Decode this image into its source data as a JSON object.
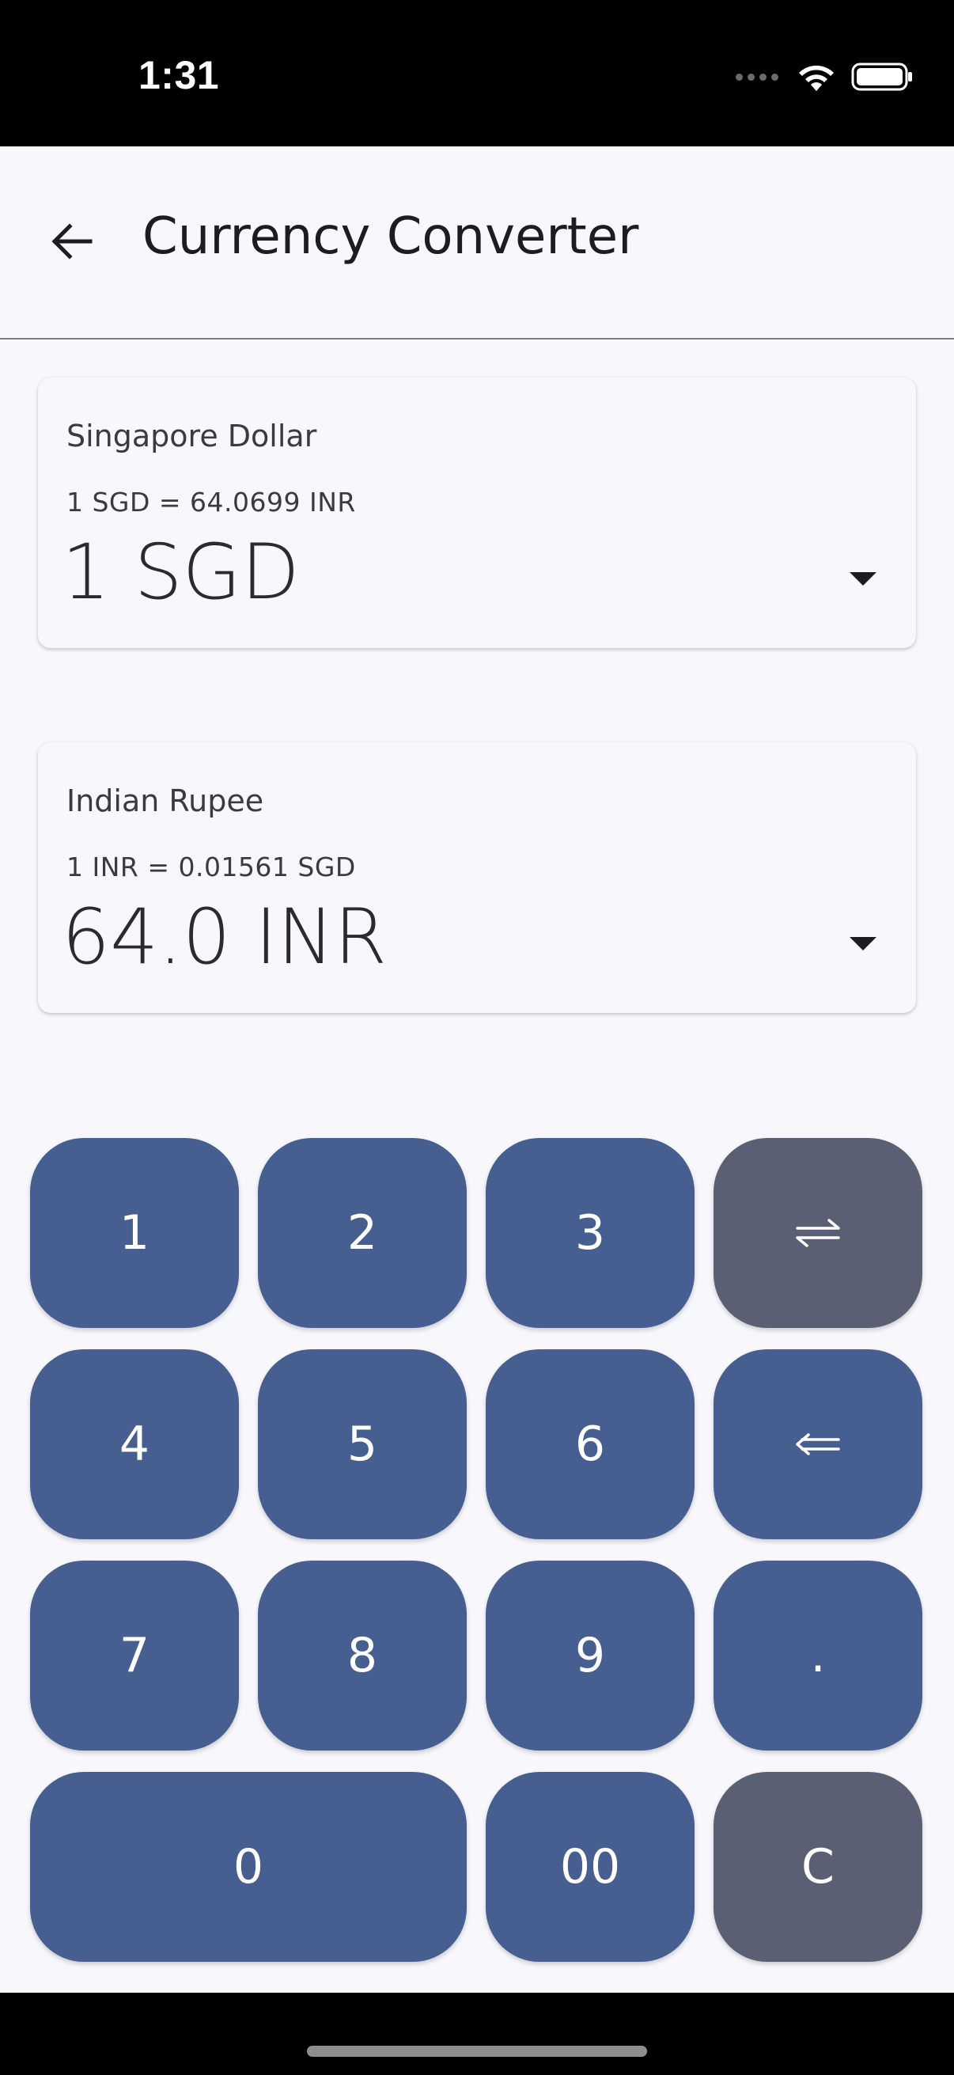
{
  "status_bar": {
    "time": "1:31"
  },
  "app_bar": {
    "title": "Currency Converter"
  },
  "from_currency": {
    "name": "Singapore Dollar",
    "rate": "1 SGD = 64.0699 INR",
    "amount": "1 SGD"
  },
  "to_currency": {
    "name": "Indian Rupee",
    "rate": "1 INR = 0.01561 SGD",
    "amount": "64.0 INR"
  },
  "keypad": {
    "k1": "1",
    "k2": "2",
    "k3": "3",
    "k4": "4",
    "k5": "5",
    "k6": "6",
    "k7": "7",
    "k8": "8",
    "k9": "9",
    "dot": ".",
    "k0": "0",
    "k00": "00",
    "clear": "C",
    "swap_icon": "swap-arrows-icon",
    "backspace_icon": "backspace-arrow-icon"
  },
  "colors": {
    "key_primary": "#475e91",
    "key_secondary": "#5b5f73",
    "background": "#f7f7fc"
  }
}
